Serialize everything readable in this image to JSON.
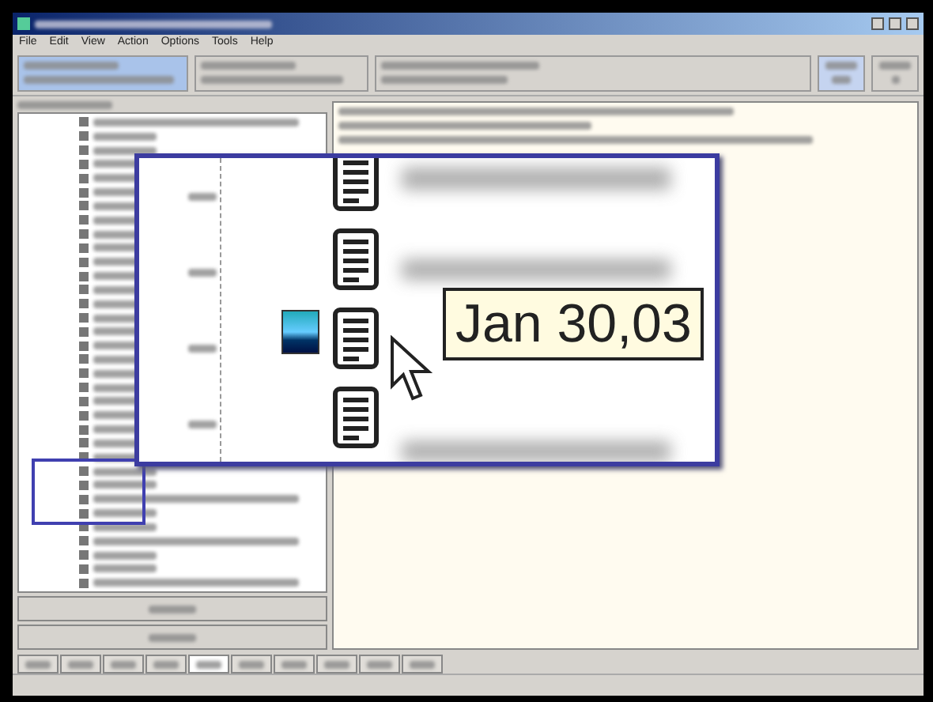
{
  "menu": [
    {
      "label": "File"
    },
    {
      "label": "Edit"
    },
    {
      "label": "View"
    },
    {
      "label": "Action"
    },
    {
      "label": "Options"
    },
    {
      "label": "Tools"
    },
    {
      "label": "Help"
    }
  ],
  "tabs": [
    {
      "selected": false
    },
    {
      "selected": false
    },
    {
      "selected": false
    },
    {
      "selected": false
    },
    {
      "selected": true
    },
    {
      "selected": false
    },
    {
      "selected": false
    },
    {
      "selected": false
    },
    {
      "selected": false
    },
    {
      "selected": false
    }
  ],
  "magnifier": {
    "tooltip": "Jan 30,03"
  }
}
